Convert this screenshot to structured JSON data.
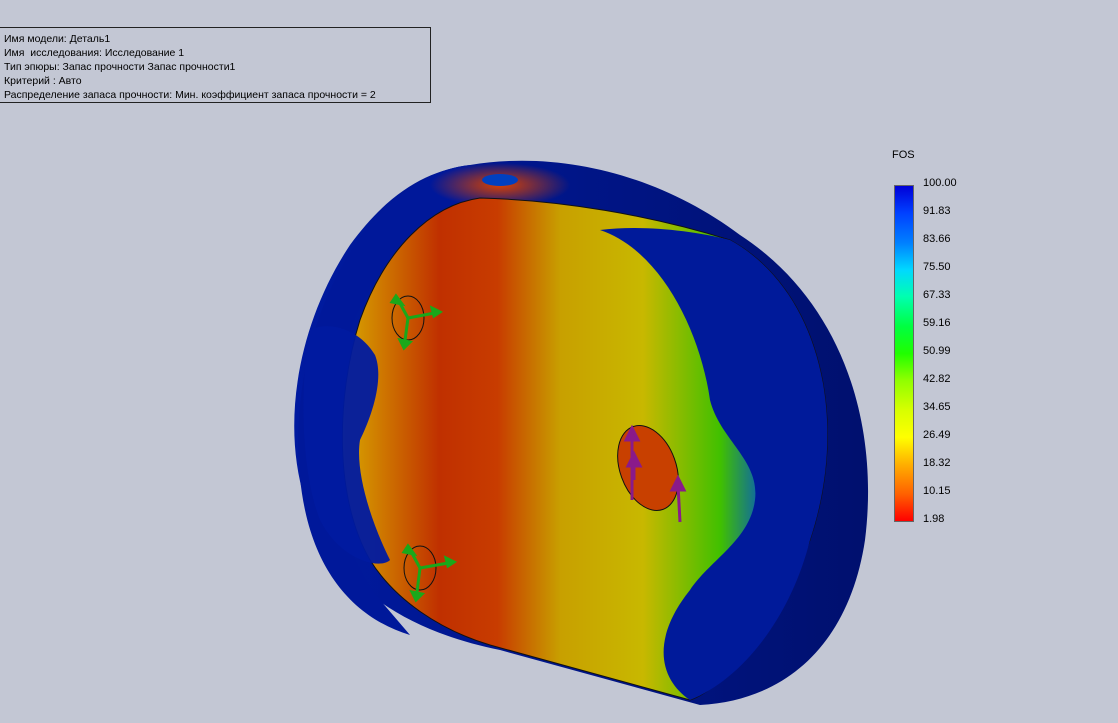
{
  "info": {
    "lines": [
      "Имя модели: Деталь1",
      "Имя  исследования: Исследование 1",
      "Тип эпюры: Запас прочности Запас прочности1",
      "Критерий : Авто",
      "Распределение запаса прочности: Мин. коэффициент запаса прочности = 2"
    ]
  },
  "legend": {
    "title": "FOS",
    "labels": [
      "100.00",
      "91.83",
      "83.66",
      "75.50",
      "67.33",
      "59.16",
      "50.99",
      "42.82",
      "34.65",
      "26.49",
      "18.32",
      "10.15",
      "1.98"
    ],
    "colors": {
      "max": "#0000d8",
      "mid": "#ffff00",
      "min": "#ff0000"
    }
  },
  "model": {
    "body_color": "#00108a",
    "stress_color_high": "#c01800",
    "stress_color_mid": "#c8b400",
    "fixture_color": "#1aa81a",
    "load_color": "#8a1a8a"
  }
}
